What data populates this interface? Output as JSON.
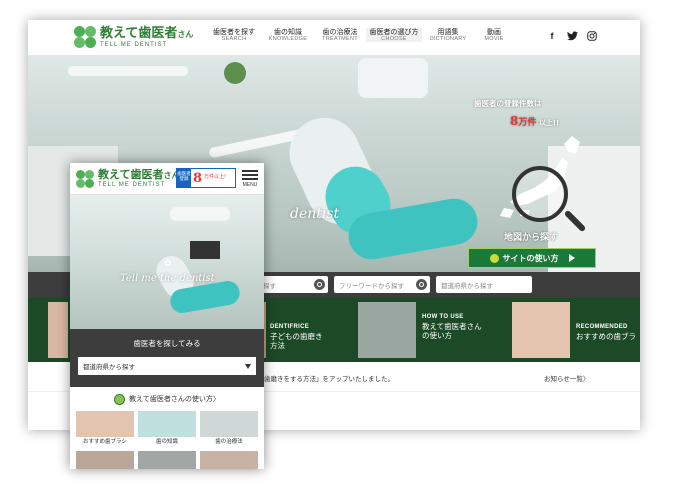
{
  "brand": {
    "name": "教えて歯医者",
    "name_suffix": "さん",
    "tagline": "TELL ME DENTIST",
    "accent": "#2e7d32"
  },
  "desktop": {
    "nav": [
      {
        "jp": "歯医者を探す",
        "en": "SEARCH"
      },
      {
        "jp": "歯の知識",
        "en": "KNOWLEDGE"
      },
      {
        "jp": "歯の治療法",
        "en": "TREATMENT"
      },
      {
        "jp": "歯医者の選び方",
        "en": "CHOOSE"
      },
      {
        "jp": "用語集",
        "en": "DICTIONARY"
      },
      {
        "jp": "動画",
        "en": "MOVIE"
      }
    ],
    "social": [
      "f",
      "t",
      "ig"
    ],
    "hero": {
      "tagline": "dentist",
      "promo_line1": "歯医者の登録件数は",
      "promo_number": "8",
      "promo_line2_suffix": "万件",
      "promo_line2_end": "以上!!",
      "map_label": "地図から探す",
      "howto_button": "サイトの使い方"
    },
    "search": {
      "field1": "探す",
      "field2": "フリーワードから探す",
      "field3": "都道府県から探す"
    },
    "categories": [
      {
        "en": "DENTIFRICE",
        "jp": "子どもの歯磨き方法"
      },
      {
        "en": "HOW TO USE",
        "jp": "教えて歯医者さん",
        "jp2": "の使い方"
      },
      {
        "en": "RECOMMENDED",
        "jp": "おすすめの歯ブラ"
      }
    ],
    "news": {
      "text": "歯磨きをする方法」をアップいたしました。",
      "more": "お知らせ一覧〉"
    },
    "colors": {
      "dark_green": "#1d4a26",
      "search_bar": "#3d3d3d",
      "teal_chair": "#3ec3c0"
    }
  },
  "mobile": {
    "badge": {
      "label": "歯医者登録",
      "number": "8",
      "text1": "万件以上!"
    },
    "menu_label": "MENU",
    "hero_tagline": "Tell me the",
    "hero_tagline_end": "dentist",
    "search_title": "歯医者を探してみる",
    "select_placeholder": "都道府県から探す",
    "howto": "教えて歯医者さんの使い方〉",
    "tiles": [
      {
        "label": "おすすめ歯ブラシ"
      },
      {
        "label": "歯の知識"
      },
      {
        "label": "歯の治療法"
      }
    ]
  }
}
